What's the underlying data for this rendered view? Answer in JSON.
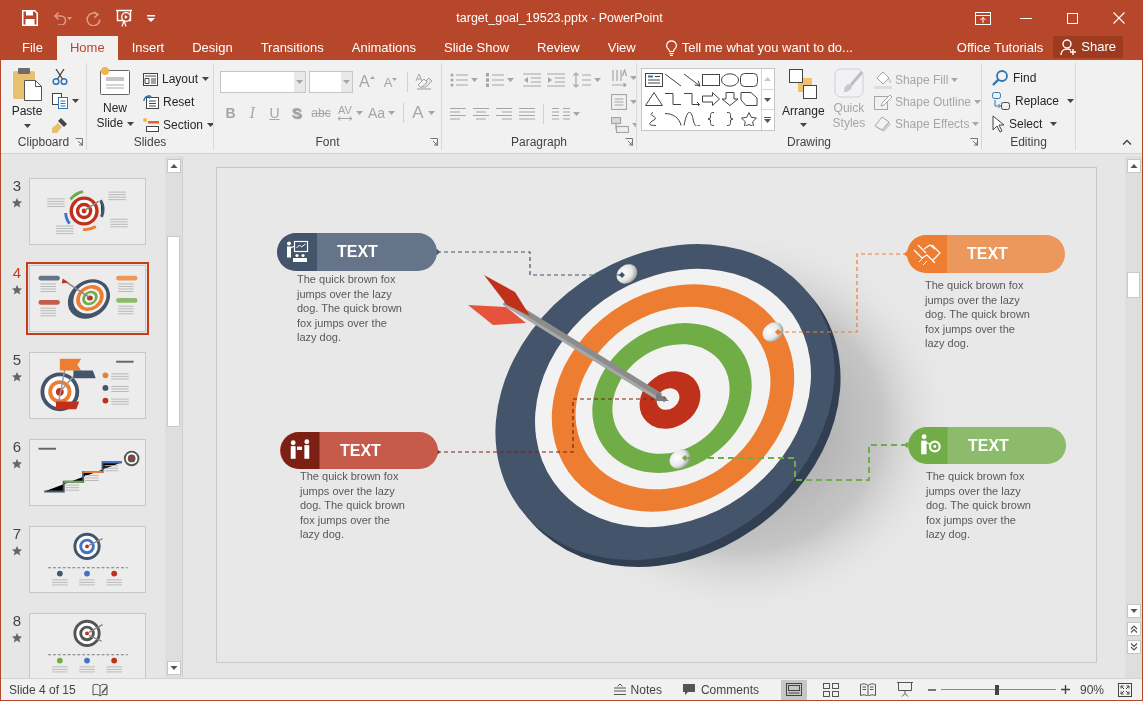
{
  "window": {
    "title": "target_goal_19523.pptx - PowerPoint"
  },
  "quick_access": [
    {
      "kind": "save",
      "disabled": false
    },
    {
      "kind": "undo",
      "disabled": true
    },
    {
      "kind": "redo",
      "disabled": true
    },
    {
      "kind": "present",
      "disabled": false
    },
    {
      "kind": "customize",
      "disabled": false
    }
  ],
  "tabs": [
    {
      "label": "File",
      "selected": false
    },
    {
      "label": "Home",
      "selected": true
    },
    {
      "label": "Insert",
      "selected": false
    },
    {
      "label": "Design",
      "selected": false
    },
    {
      "label": "Transitions",
      "selected": false
    },
    {
      "label": "Animations",
      "selected": false
    },
    {
      "label": "Slide Show",
      "selected": false
    },
    {
      "label": "Review",
      "selected": false
    },
    {
      "label": "View",
      "selected": false
    }
  ],
  "tell_me": {
    "placeholder": "Tell me what you want to do..."
  },
  "account": {
    "name": "Office Tutorials"
  },
  "share_button": {
    "label": "Share"
  },
  "ribbon": {
    "groups": [
      {
        "kind": "clipboard",
        "label": "Clipboard",
        "disabled": false,
        "buttons": [
          {
            "label": "Paste",
            "disabled": false
          }
        ]
      },
      {
        "kind": "slides",
        "label": "Slides",
        "disabled": false,
        "buttons": [
          {
            "label": "New Slide",
            "disabled": false
          },
          {
            "label": "Layout",
            "disabled": false
          },
          {
            "label": "Reset",
            "disabled": false
          },
          {
            "label": "Section",
            "disabled": false
          }
        ]
      },
      {
        "kind": "font",
        "label": "Font",
        "disabled": true,
        "buttons": [
          {
            "kind": "grow",
            "label": "A"
          },
          {
            "kind": "shrink",
            "label": "A"
          },
          {
            "kind": "bold",
            "label": "B"
          },
          {
            "kind": "italic",
            "label": "I"
          },
          {
            "kind": "underline",
            "label": "U"
          },
          {
            "kind": "shadow",
            "label": "S"
          },
          {
            "kind": "strike",
            "label": "abc"
          },
          {
            "kind": "spacing",
            "label": "AV"
          },
          {
            "kind": "case",
            "label": "Aa"
          },
          {
            "kind": "color",
            "label": "A"
          }
        ]
      },
      {
        "kind": "paragraph",
        "label": "Paragraph",
        "disabled": true
      },
      {
        "kind": "drawing",
        "label": "Drawing",
        "disabled": false,
        "buttons": [
          {
            "label": "Arrange",
            "disabled": false
          },
          {
            "label": "Quick Styles",
            "disabled": true
          },
          {
            "label": "Shape Fill",
            "disabled": true
          },
          {
            "label": "Shape Outline",
            "disabled": true
          },
          {
            "label": "Shape Effects",
            "disabled": true
          }
        ]
      },
      {
        "kind": "editing",
        "label": "Editing",
        "disabled": false,
        "buttons": [
          {
            "label": "Find",
            "disabled": false
          },
          {
            "label": "Replace",
            "disabled": false
          },
          {
            "label": "Select",
            "disabled": false
          }
        ]
      }
    ]
  },
  "slides": [
    {
      "number": "3",
      "kind": "cycle",
      "animated": true,
      "selected": false
    },
    {
      "number": "4",
      "kind": "callouts",
      "animated": true,
      "selected": true
    },
    {
      "number": "5",
      "kind": "flags",
      "animated": true,
      "selected": false
    },
    {
      "number": "6",
      "kind": "steps",
      "animated": true,
      "selected": false
    },
    {
      "number": "7",
      "kind": "timeline",
      "animated": true,
      "selected": false
    },
    {
      "number": "8",
      "kind": "dual",
      "animated": true,
      "selected": false
    }
  ],
  "slide": {
    "callouts": [
      {
        "title": "TEXT",
        "body": "The quick brown fox jumps over the lazy dog. The quick brown fox jumps over the lazy dog.",
        "color": "#66748a",
        "icon": {
          "color": "#44546a"
        }
      },
      {
        "title": "TEXT",
        "body": "The quick brown fox jumps over the lazy dog. The quick brown fox jumps over the lazy dog.",
        "color": "#ec975b",
        "icon": {
          "color": "#ed7d31"
        }
      },
      {
        "title": "TEXT",
        "body": "The quick brown fox jumps over the lazy dog. The quick brown fox jumps over the lazy dog.",
        "color": "#c65a4b",
        "icon": {
          "color": "#7b2012"
        }
      },
      {
        "title": "TEXT",
        "body": "The quick brown fox jumps over the lazy dog. The quick brown fox jumps over the lazy dog.",
        "color": "#8cbb6b",
        "icon": {
          "color": "#70ad47"
        }
      }
    ]
  },
  "status_bar": {
    "slide_counter": "Slide 4 of 15",
    "notes": "Notes",
    "comments": "Comments",
    "views": [
      {
        "kind": "normal",
        "selected": true
      },
      {
        "kind": "sorter",
        "selected": false
      },
      {
        "kind": "reading",
        "selected": false
      },
      {
        "kind": "slideshow",
        "selected": false
      }
    ],
    "zoom": {
      "level": 0.49,
      "reading": "90%"
    }
  }
}
